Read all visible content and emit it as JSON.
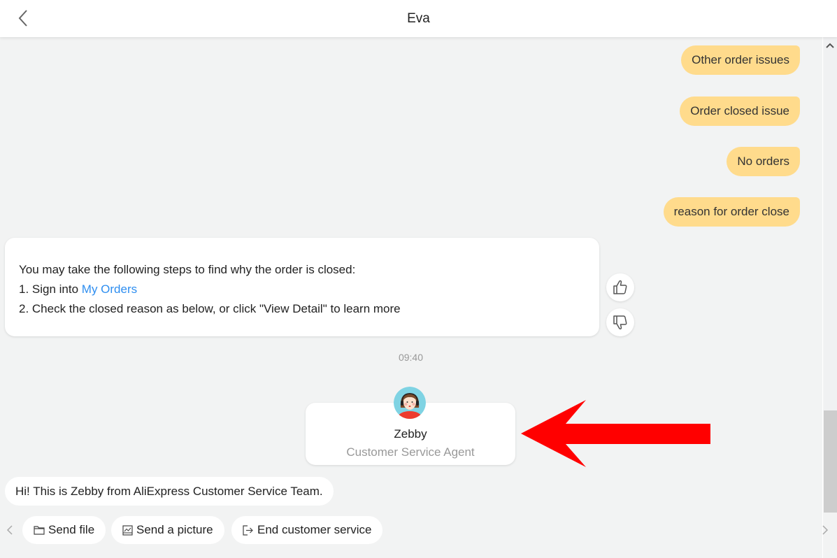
{
  "header": {
    "title": "Eva",
    "back_icon": "chevron-left-icon"
  },
  "user_messages": [
    "Other order issues",
    "Order closed issue",
    "No orders",
    "reason for order close"
  ],
  "bot_message": {
    "line1": "You may take the following steps to find why the order is closed:",
    "line2_prefix": "1. Sign into ",
    "line2_link": "My Orders",
    "line3": "2. Check the closed reason as below, or click \"View Detail\" to learn more",
    "link_color": "#2e8ef0"
  },
  "feedback": {
    "like_icon": "thumbs-up-icon",
    "dislike_icon": "thumbs-down-icon"
  },
  "timestamp": "09:40",
  "agent": {
    "name": "Zebby",
    "role": "Customer Service Agent",
    "avatar_icon": "agent-avatar-icon"
  },
  "greeting": "Hi! This is Zebby from AliExpress Customer Service Team.",
  "annotation": {
    "arrow_color": "#ff0000",
    "arrow_icon": "red-arrow-left-icon"
  },
  "toolbar": {
    "send_file": "Send file",
    "send_picture": "Send a picture",
    "end_service": "End customer service"
  },
  "colors": {
    "user_bubble": "#ffdb8c",
    "background": "#f2f3f3"
  }
}
